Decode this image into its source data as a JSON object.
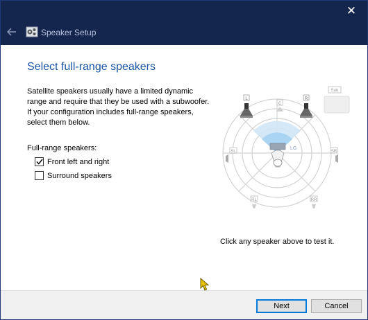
{
  "window": {
    "title": "Speaker Setup",
    "close_glyph": "✕"
  },
  "page": {
    "heading": "Select full-range speakers",
    "description": "Satellite speakers usually have a limited dynamic range and require that they be used with a subwoofer.  If your configuration includes full-range speakers, select them below.",
    "group_label": "Full-range speakers:",
    "options": [
      {
        "label": "Front left and right",
        "checked": true
      },
      {
        "label": "Surround speakers",
        "checked": false
      }
    ],
    "hint": "Click any speaker above to test it."
  },
  "diagram": {
    "speaker_labels": [
      "L",
      "C",
      "R",
      "Sub",
      "SL",
      "SR",
      "RL",
      "RR"
    ],
    "listener_label": "LG"
  },
  "buttons": {
    "next": "Next",
    "cancel": "Cancel"
  },
  "colors": {
    "titlebar": "#15264e",
    "heading": "#1a55a6",
    "accent": "#0078d7"
  }
}
